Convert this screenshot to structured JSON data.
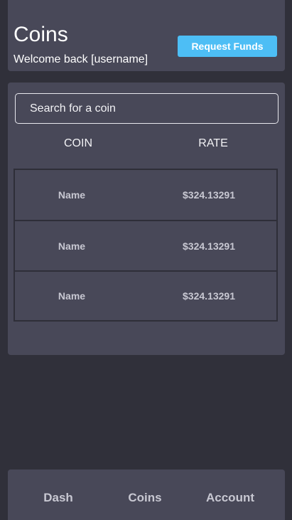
{
  "header": {
    "title": "Coins",
    "welcome": "Welcome back [username]",
    "request_funds_label": "Request Funds"
  },
  "search": {
    "placeholder": "Search for a coin",
    "value": ""
  },
  "table": {
    "columns": [
      "COIN",
      "RATE"
    ],
    "rows": [
      {
        "name": "Name",
        "rate": "$324.13291"
      },
      {
        "name": "Name",
        "rate": "$324.13291"
      },
      {
        "name": "Name",
        "rate": "$324.13291"
      }
    ]
  },
  "nav": {
    "items": [
      {
        "label": "Dash"
      },
      {
        "label": "Coins"
      },
      {
        "label": "Account"
      }
    ]
  },
  "colors": {
    "background": "#30303a",
    "card": "#484858",
    "accent": "#4dbef5",
    "muted_text": "#c8c8d2"
  }
}
